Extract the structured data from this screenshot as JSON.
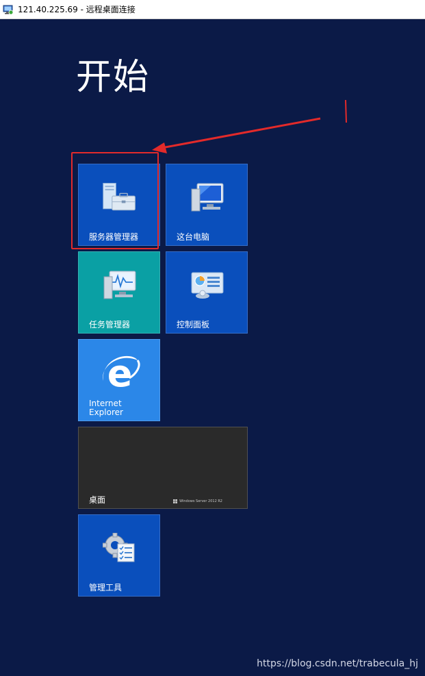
{
  "window": {
    "title": "121.40.225.69 - 远程桌面连接",
    "icon": "remote-desktop-icon"
  },
  "start": {
    "heading": "开始"
  },
  "tiles": [
    {
      "id": "server-manager",
      "label": "服务器管理器",
      "icon": "server-manager-icon",
      "color": "#0a4fbc"
    },
    {
      "id": "this-pc",
      "label": "这台电脑",
      "icon": "computer-icon",
      "color": "#0a4fbc"
    },
    {
      "id": "task-manager",
      "label": "任务管理器",
      "icon": "task-manager-icon",
      "color": "#0aa0a4"
    },
    {
      "id": "control-panel",
      "label": "控制面板",
      "icon": "control-panel-icon",
      "color": "#0a4fbc"
    },
    {
      "id": "internet-explorer",
      "label_line1": "Internet",
      "label_line2": "Explorer",
      "icon": "internet-explorer-icon",
      "color": "#2b87e8"
    },
    {
      "id": "desktop",
      "label": "桌面",
      "brand": "Windows Server 2012 R2",
      "color": "#2a2a2a"
    },
    {
      "id": "admin-tools",
      "label": "管理工具",
      "icon": "admin-tools-icon",
      "color": "#0a4fbc"
    }
  ],
  "annotation": {
    "highlight_color": "#e32a2a",
    "target": "server-manager"
  },
  "watermark": "https://blog.csdn.net/trabecula_hj"
}
